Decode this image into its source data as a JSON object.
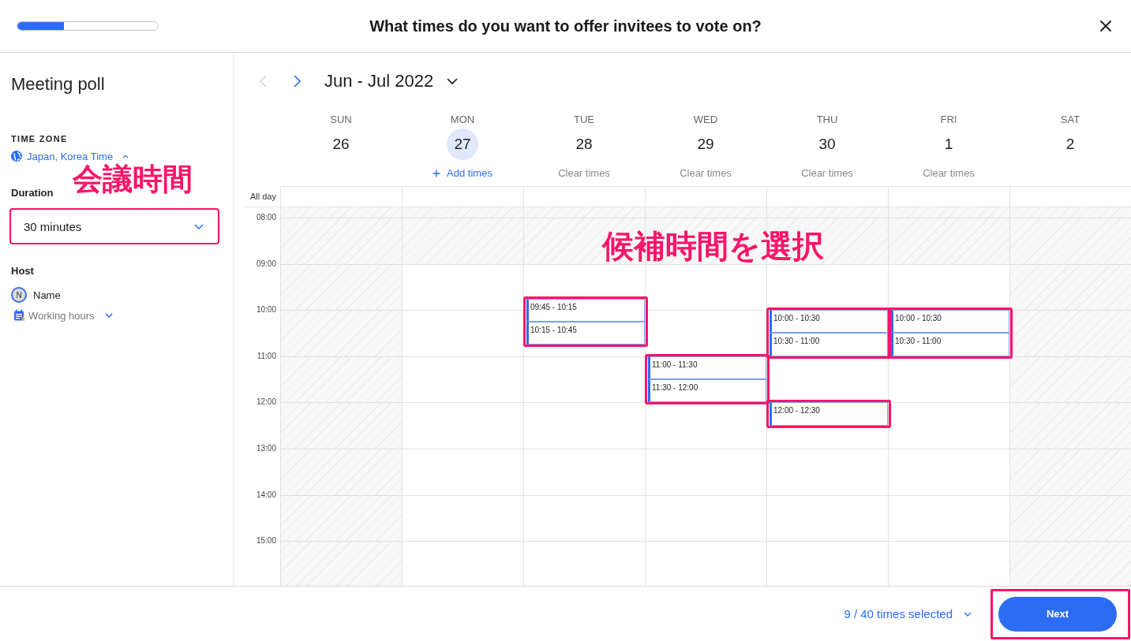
{
  "header": {
    "progress": {
      "level": 0.33
    },
    "title": "What times do you want to offer invitees to vote on?"
  },
  "sidebar": {
    "title": "Meeting poll",
    "time_zone": {
      "label": "TIME ZONE",
      "value": "Japan, Korea Time"
    },
    "annotation": "会議時間",
    "duration": {
      "label": "Duration",
      "value": "30 minutes",
      "highlighted": true
    },
    "host": {
      "label": "Host",
      "initial": "N",
      "name": "Name",
      "working_hours": "Working hours"
    }
  },
  "calendar": {
    "previous_disabled": true,
    "range": "Jun - Jul 2022",
    "days": [
      {
        "weekday": "SUN",
        "date": "26",
        "today": false,
        "working": false
      },
      {
        "weekday": "MON",
        "date": "27",
        "today": true,
        "working": true,
        "action": {
          "kind": "add",
          "label": "Add times"
        }
      },
      {
        "weekday": "TUE",
        "date": "28",
        "today": false,
        "working": true,
        "action": {
          "kind": "clear",
          "label": "Clear times"
        },
        "slot_groups": [
          {
            "highlighted": true,
            "slots": [
              "09:45 - 10:15",
              "10:15 - 10:45"
            ]
          }
        ]
      },
      {
        "weekday": "WED",
        "date": "29",
        "today": false,
        "working": true,
        "action": {
          "kind": "clear",
          "label": "Clear times"
        },
        "slot_groups": [
          {
            "highlighted": true,
            "slots": [
              "11:00 - 11:30",
              "11:30 - 12:00"
            ]
          }
        ]
      },
      {
        "weekday": "THU",
        "date": "30",
        "today": false,
        "working": true,
        "action": {
          "kind": "clear",
          "label": "Clear times"
        },
        "slot_groups": [
          {
            "highlighted": true,
            "slots": [
              "10:00 - 10:30",
              "10:30 - 11:00"
            ]
          },
          {
            "highlighted": true,
            "slots": [
              "12:00 - 12:30"
            ]
          }
        ]
      },
      {
        "weekday": "FRI",
        "date": "1",
        "today": false,
        "working": true,
        "action": {
          "kind": "clear",
          "label": "Clear times"
        },
        "slot_groups": [
          {
            "highlighted": true,
            "slots": [
              "10:00 - 10:30",
              "10:30 - 11:00"
            ]
          }
        ]
      },
      {
        "weekday": "SAT",
        "date": "2",
        "today": false,
        "working": false
      }
    ],
    "all_day_label": "All day",
    "hours": [
      {
        "label": "08:00",
        "working": false
      },
      {
        "label": "09:00",
        "working": true
      },
      {
        "label": "10:00",
        "working": true
      },
      {
        "label": "11:00",
        "working": true
      },
      {
        "label": "12:00",
        "working": true
      },
      {
        "label": "13:00",
        "working": true
      },
      {
        "label": "14:00",
        "working": true
      },
      {
        "label": "15:00",
        "working": true
      }
    ],
    "annotation": "候補時間を選択"
  },
  "footer": {
    "selection": "9 / 40 times selected",
    "next": {
      "label": "Next",
      "highlighted": true
    }
  }
}
